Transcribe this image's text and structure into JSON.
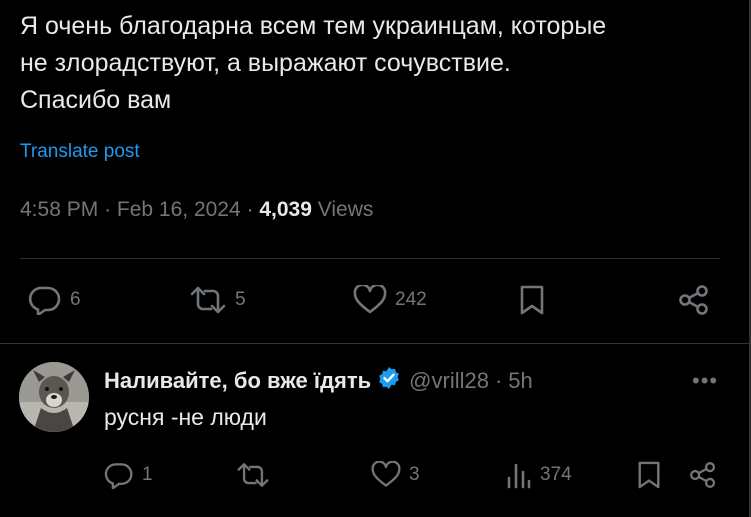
{
  "post": {
    "text": "Я очень благодарна всем тем украинцам, которые\nне злорадствуют, а выражают сочувствие.\nСпасибо вам",
    "translate_label": "Translate post",
    "time": "4:58 PM",
    "date": "Feb 16, 2024",
    "views_count": "4,039",
    "views_label": "Views",
    "actions": {
      "replies": "6",
      "reposts": "5",
      "likes": "242",
      "bookmark_icon": "bookmark-icon",
      "share_icon": "share-icon"
    }
  },
  "reply": {
    "name": "Наливайте, бо вже їдять",
    "handle": "@vrill28",
    "time": "5h",
    "text": "русня -не люди",
    "actions": {
      "replies": "1",
      "reposts": "",
      "likes": "3",
      "views": "374"
    }
  },
  "colors": {
    "background": "#000000",
    "text": "#e7e9ea",
    "muted": "#71767b",
    "accent": "#1d9bf0",
    "divider": "#2f3336"
  }
}
